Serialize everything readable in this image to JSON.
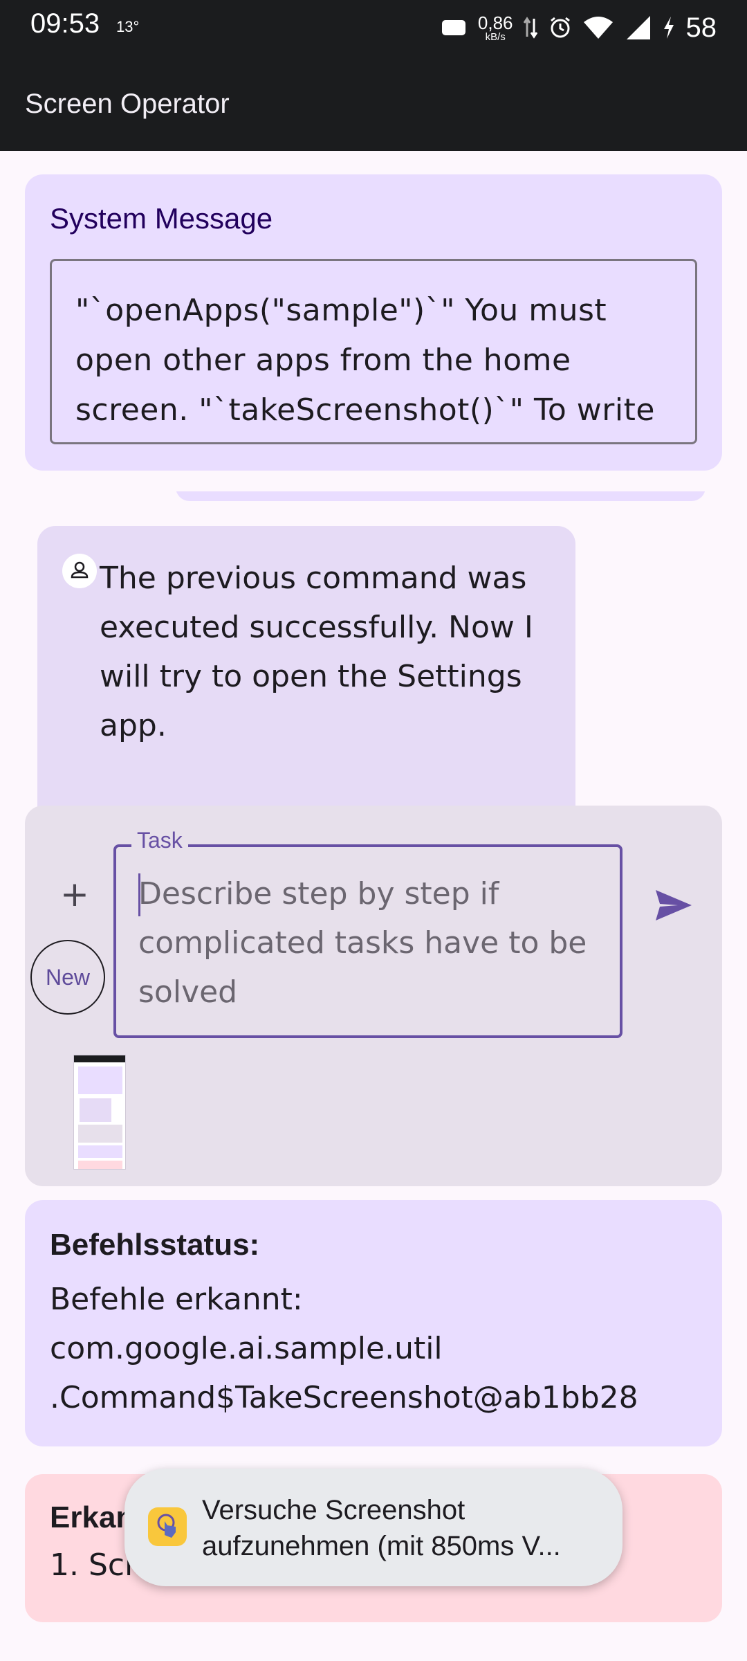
{
  "status_bar": {
    "time": "09:53",
    "temperature": "13°",
    "net_speed_value": "0,86",
    "net_speed_unit": "kB/s",
    "battery": "58",
    "icons": [
      "message-icon",
      "data-arrows-icon",
      "alarm-icon",
      "wifi-icon",
      "signal-icon",
      "charging-icon"
    ]
  },
  "app_bar": {
    "title": "Screen Operator"
  },
  "system_message": {
    "title": "System Message",
    "text": "\"`openApps(\"sample\")`\"  You must open other apps from the home screen. \"`takeScreenshot()`\" To write"
  },
  "model_message": {
    "text": "The previous command was executed successfully. Now I will try to open the Settings app."
  },
  "input": {
    "add_symbol": "+",
    "new_label": "New",
    "task_label": "Task",
    "task_placeholder": "Describe step by step if complicated tasks have to be solved",
    "send_icon": "send-icon"
  },
  "command_status": {
    "title": "Befehlsstatus:",
    "line1": "Befehle erkannt:",
    "line2": "com.google.ai.sample.util",
    "line3": ".Command$TakeScreenshot@ab1bb28"
  },
  "error_card": {
    "title": "Erkan",
    "item": "1. Scre"
  },
  "toast": {
    "text": "Versuche Screenshot aufzunehmen (mit 850ms V..."
  },
  "colors": {
    "app_bar": "#1b1c1e",
    "system_card": "#e9ddff",
    "message_bubble": "#e6dbf6",
    "input_panel": "#e7e0eb",
    "accent": "#6750a4",
    "error_card": "#ffd9e0"
  }
}
